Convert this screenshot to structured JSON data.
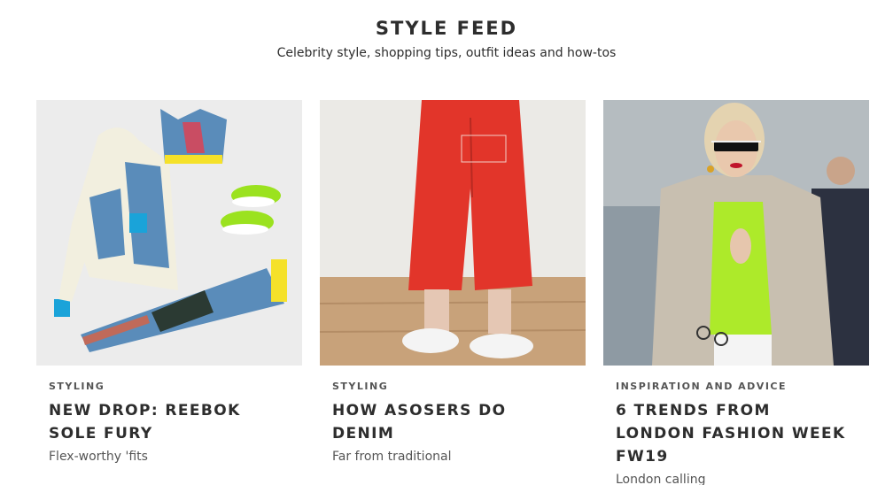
{
  "header": {
    "title": "STYLE FEED",
    "subtitle": "Celebrity style, shopping tips, outfit ideas and how-tos"
  },
  "cards": [
    {
      "category": "STYLING",
      "headline": "NEW DROP: REEBOK SOLE FURY",
      "tagline": "Flex-worthy 'fits"
    },
    {
      "category": "STYLING",
      "headline": "HOW ASOSERS DO DENIM",
      "tagline": "Far from traditional"
    },
    {
      "category": "INSPIRATION AND ADVICE",
      "headline": "6 TRENDS FROM LONDON FASHION WEEK FW19",
      "tagline": "London calling"
    }
  ]
}
